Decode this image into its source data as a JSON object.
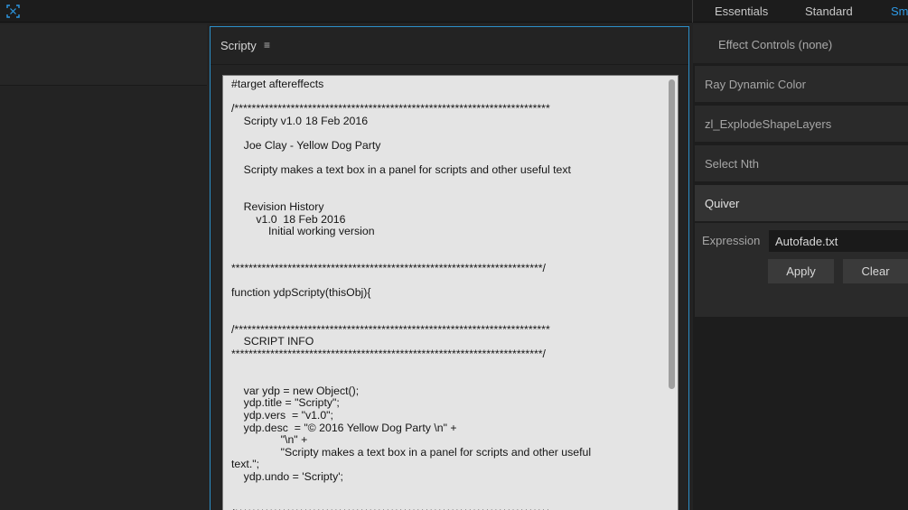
{
  "topbar": {
    "app_icon": "composition-focus-icon",
    "workspaces": [
      "Essentials",
      "Standard",
      "Sma"
    ],
    "active_workspace": "Sma",
    "active_color": "#2d9ae6"
  },
  "scripty_panel": {
    "title": "Scripty",
    "menu_glyph": "≡",
    "border_color": "#2c8fc9",
    "code": "#target aftereffects\n\n/*************************************************************************\n\tScripty v1.0\t18 Feb 2016\n\n\tJoe Clay - Yellow Dog Party\n\n\tScripty makes a text box in a panel for scripts and other useful text\n\n\n\tRevision History\n\t\tv1.0  18 Feb 2016\n\t\t\tInitial working version\n\n\n************************************************************************/\n\nfunction ydpScripty(thisObj){\n\n\n/*************************************************************************\n\tSCRIPT INFO\n************************************************************************/\n\n\n\tvar ydp = new Object();\n\tydp.title = \"Scripty\";\n\tydp.vers  = \"v1.0\";\n\tydp.desc  = \"© 2016 Yellow Dog Party \\n\" +\n\t\t\t\t\"\\n\" +\n\t\t\t\t\"Scripty makes a text box in a panel for scripts and other useful\ntext.\";\n\tydp.undo = 'Scripty';\n\n\n/*************************************************************************\n\tCREATE PALETTE"
  },
  "right_panel": {
    "effect_controls_title": "Effect Controls (none)",
    "scripts": [
      {
        "label": "Ray Dynamic Color"
      },
      {
        "label": "zl_ExplodeShapeLayers"
      },
      {
        "label": "Select Nth"
      },
      {
        "label": "Quiver"
      }
    ],
    "selected_script": "Quiver",
    "quiver": {
      "expression_label": "Expression",
      "expression_value": "Autofade.txt",
      "apply_label": "Apply",
      "clear_label": "Clear"
    }
  }
}
